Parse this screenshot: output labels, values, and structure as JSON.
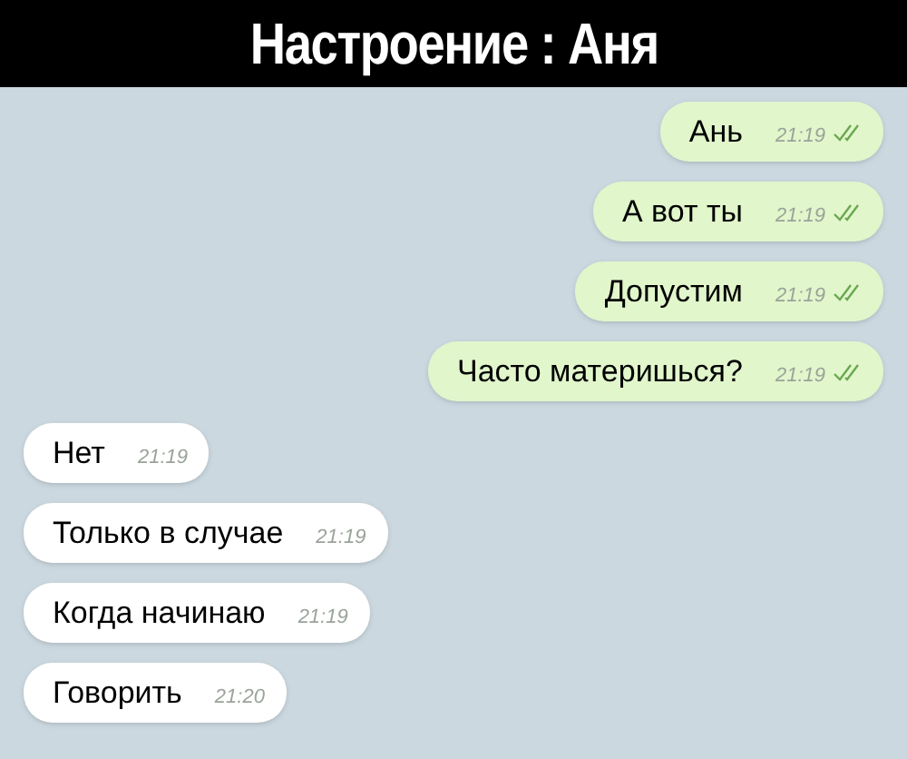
{
  "title": "Настроение : Аня",
  "messages": [
    {
      "kind": "out",
      "text": "Ань",
      "time": "21:19",
      "read": true
    },
    {
      "kind": "out",
      "text": "А вот ты",
      "time": "21:19",
      "read": true
    },
    {
      "kind": "out",
      "text": "Допустим",
      "time": "21:19",
      "read": true
    },
    {
      "kind": "out",
      "text": "Часто материшься?",
      "time": "21:19",
      "read": true
    },
    {
      "kind": "in",
      "text": "Нет",
      "time": "21:19"
    },
    {
      "kind": "in",
      "text": "Только в случае",
      "time": "21:19"
    },
    {
      "kind": "in",
      "text": "Когда начинаю",
      "time": "21:19"
    },
    {
      "kind": "in",
      "text": "Говорить",
      "time": "21:20"
    }
  ]
}
